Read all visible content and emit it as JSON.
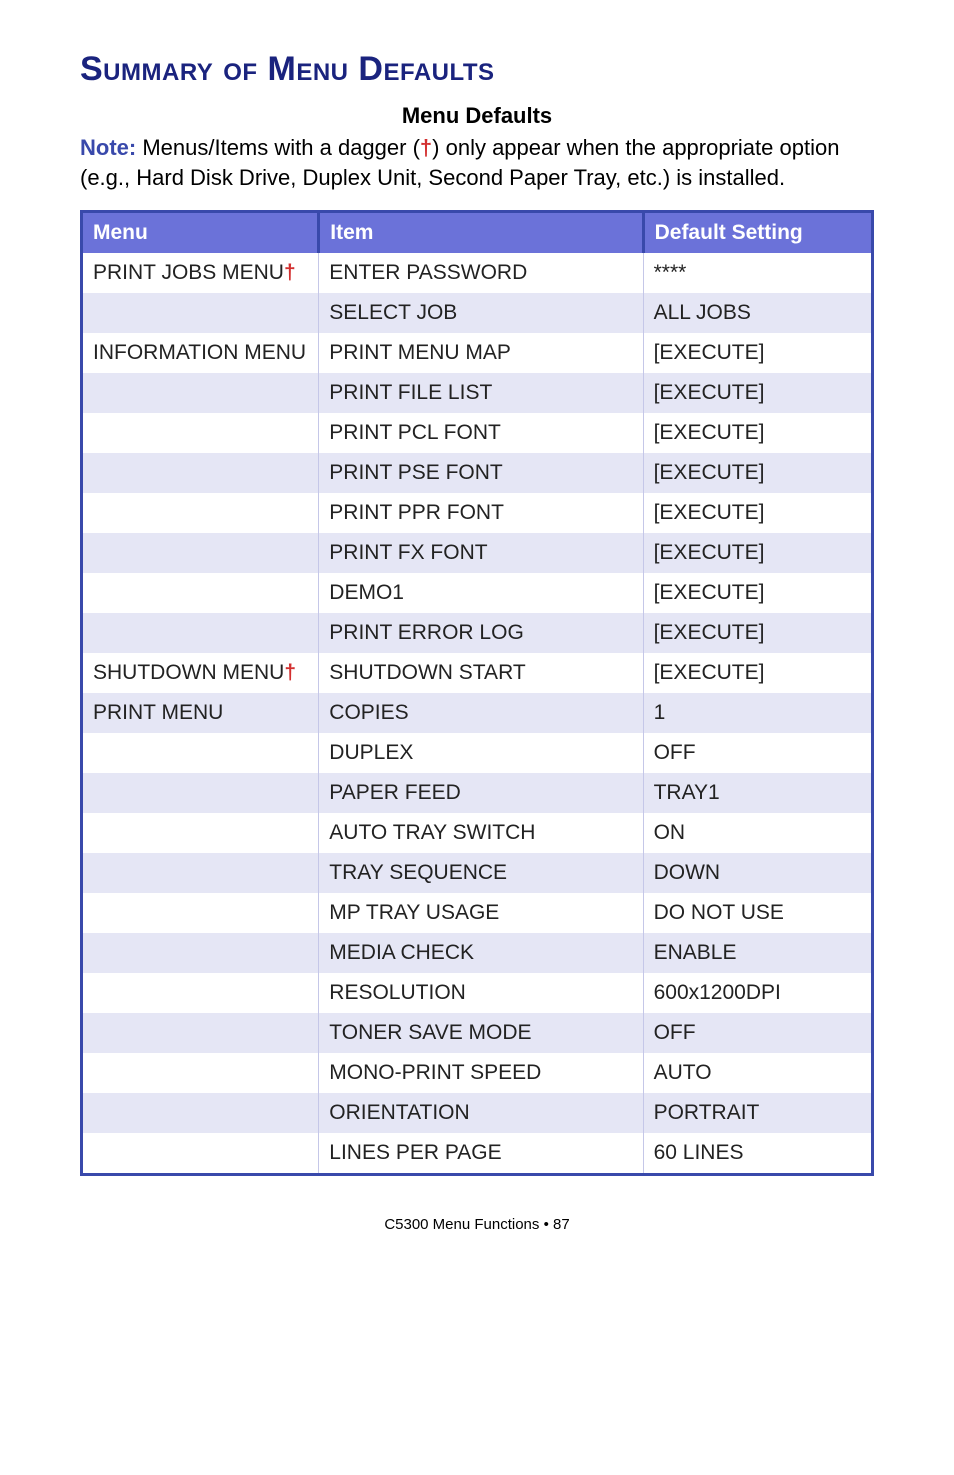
{
  "heading": "Summary of Menu Defaults",
  "subheading": "Menu Defaults",
  "note_label": "Note:",
  "note_text_1": " Menus/Items with a dagger (",
  "note_dagger": "†",
  "note_text_2": ") only appear when the appropriate option (e.g., Hard Disk Drive, Duplex Unit, Second Paper Tray, etc.) is installed.",
  "columns": {
    "menu": "Menu",
    "item": "Item",
    "default": "Default Setting"
  },
  "rows": [
    {
      "menu": "PRINT JOBS MENU",
      "menu_dagger": true,
      "item": "ENTER PASSWORD",
      "default": "****"
    },
    {
      "menu": "",
      "menu_dagger": false,
      "item": "SELECT JOB",
      "default": "ALL JOBS"
    },
    {
      "menu": "INFORMATION MENU",
      "menu_dagger": false,
      "item": "PRINT MENU MAP",
      "default": "[EXECUTE]"
    },
    {
      "menu": "",
      "menu_dagger": false,
      "item": "PRINT FILE LIST",
      "default": "[EXECUTE]"
    },
    {
      "menu": "",
      "menu_dagger": false,
      "item": "PRINT PCL FONT",
      "default": "[EXECUTE]"
    },
    {
      "menu": "",
      "menu_dagger": false,
      "item": "PRINT PSE FONT",
      "default": "[EXECUTE]"
    },
    {
      "menu": "",
      "menu_dagger": false,
      "item": "PRINT PPR FONT",
      "default": "[EXECUTE]"
    },
    {
      "menu": "",
      "menu_dagger": false,
      "item": "PRINT FX FONT",
      "default": "[EXECUTE]"
    },
    {
      "menu": "",
      "menu_dagger": false,
      "item": "DEMO1",
      "default": "[EXECUTE]"
    },
    {
      "menu": "",
      "menu_dagger": false,
      "item": "PRINT ERROR LOG",
      "default": "[EXECUTE]"
    },
    {
      "menu": "SHUTDOWN MENU",
      "menu_dagger": true,
      "item": "SHUTDOWN START",
      "default": "[EXECUTE]"
    },
    {
      "menu": "PRINT MENU",
      "menu_dagger": false,
      "item": "COPIES",
      "default": "1"
    },
    {
      "menu": "",
      "menu_dagger": false,
      "item": "DUPLEX",
      "default": "OFF"
    },
    {
      "menu": "",
      "menu_dagger": false,
      "item": "PAPER FEED",
      "default": "TRAY1"
    },
    {
      "menu": "",
      "menu_dagger": false,
      "item": "AUTO TRAY SWITCH",
      "default": "ON"
    },
    {
      "menu": "",
      "menu_dagger": false,
      "item": "TRAY SEQUENCE",
      "default": "DOWN"
    },
    {
      "menu": "",
      "menu_dagger": false,
      "item": "MP TRAY USAGE",
      "default": "DO NOT USE"
    },
    {
      "menu": "",
      "menu_dagger": false,
      "item": "MEDIA CHECK",
      "default": "ENABLE"
    },
    {
      "menu": "",
      "menu_dagger": false,
      "item": "RESOLUTION",
      "default": "600x1200DPI"
    },
    {
      "menu": "",
      "menu_dagger": false,
      "item": "TONER SAVE MODE",
      "default": "OFF"
    },
    {
      "menu": "",
      "menu_dagger": false,
      "item": "MONO-PRINT SPEED",
      "default": "AUTO"
    },
    {
      "menu": "",
      "menu_dagger": false,
      "item": "ORIENTATION",
      "default": "PORTRAIT"
    },
    {
      "menu": "",
      "menu_dagger": false,
      "item": "LINES PER PAGE",
      "default": "60 LINES"
    }
  ],
  "footer": "C5300 Menu Functions  •  87"
}
